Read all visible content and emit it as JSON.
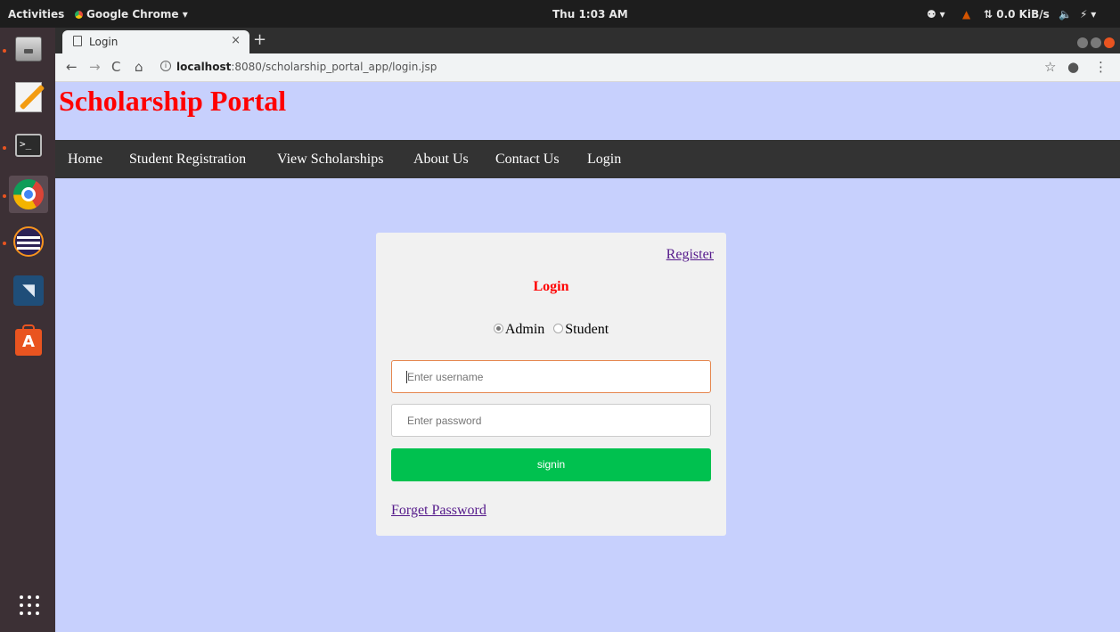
{
  "system_bar": {
    "activities": "Activities",
    "app_menu": "Google Chrome ▾",
    "clock": "Thu 1:03 AM",
    "a11y": "⚉ ▾",
    "net_speed": "⇅ 0.0 KiB/s",
    "volume": "🔈",
    "power": "⚡ ▾"
  },
  "dock": {
    "items": [
      "files",
      "text-editor",
      "terminal",
      "chrome",
      "eclipse",
      "mysql-workbench",
      "software-center",
      "show-applications"
    ],
    "terminal_glyph": ">_",
    "workbench_glyph": "◥",
    "software_glyph": "A"
  },
  "browser": {
    "tab_title": "Login",
    "tab_close": "×",
    "new_tab": "+",
    "back": "←",
    "forward": "→",
    "reload": "C",
    "home": "⌂",
    "info": "i",
    "url_host": "localhost",
    "url_rest": ":8080/scholarship_portal_app/login.jsp",
    "star": "☆",
    "profile": "●",
    "menu": "⋮"
  },
  "site": {
    "title": "Scholarship Portal",
    "nav": {
      "home": "Home",
      "student_registration": "Student Registration",
      "view_scholarships": "View Scholarships",
      "about_us": "About Us",
      "contact_us": "Contact Us",
      "login": "Login"
    }
  },
  "login_form": {
    "register_link": "Register",
    "heading": "Login",
    "roles": [
      "Admin",
      "Student"
    ],
    "selected_role": "Admin",
    "username_placeholder": "Enter username",
    "password_placeholder": "Enter password",
    "submit_label": "signin",
    "forget_password": "Forget Password"
  },
  "colors": {
    "page_bg": "#c7d0fd",
    "title_red": "#ff0000",
    "navbar_bg": "#333333",
    "signin_green": "#00c14f",
    "link_purple": "#551a8b"
  }
}
